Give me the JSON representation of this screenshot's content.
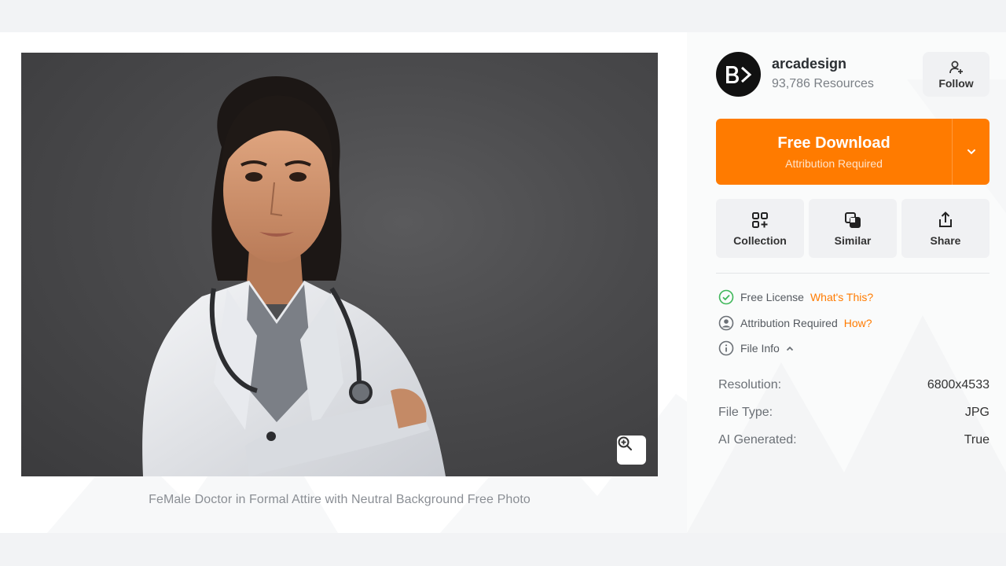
{
  "photo": {
    "caption": "FeMale Doctor in Formal Attire with Neutral Background Free Photo",
    "zoom_icon": "zoom-in-icon"
  },
  "author": {
    "avatar_text": "B>",
    "name": "arcadesign",
    "resources": "93,786 Resources",
    "follow_label": "Follow"
  },
  "download": {
    "title": "Free Download",
    "subtitle": "Attribution Required",
    "color": "#ff7b00"
  },
  "actions": [
    {
      "label": "Collection",
      "icon": "collection-add-icon"
    },
    {
      "label": "Similar",
      "icon": "similar-icon"
    },
    {
      "label": "Share",
      "icon": "share-icon"
    }
  ],
  "license": {
    "free_license": "Free License",
    "whats_this": "What's This?",
    "attribution": "Attribution Required",
    "how": "How?",
    "file_info": "File Info"
  },
  "file_info": {
    "resolution_label": "Resolution:",
    "resolution_value": "6800x4533",
    "type_label": "File Type:",
    "type_value": "JPG",
    "ai_label": "AI Generated:",
    "ai_value": "True"
  }
}
